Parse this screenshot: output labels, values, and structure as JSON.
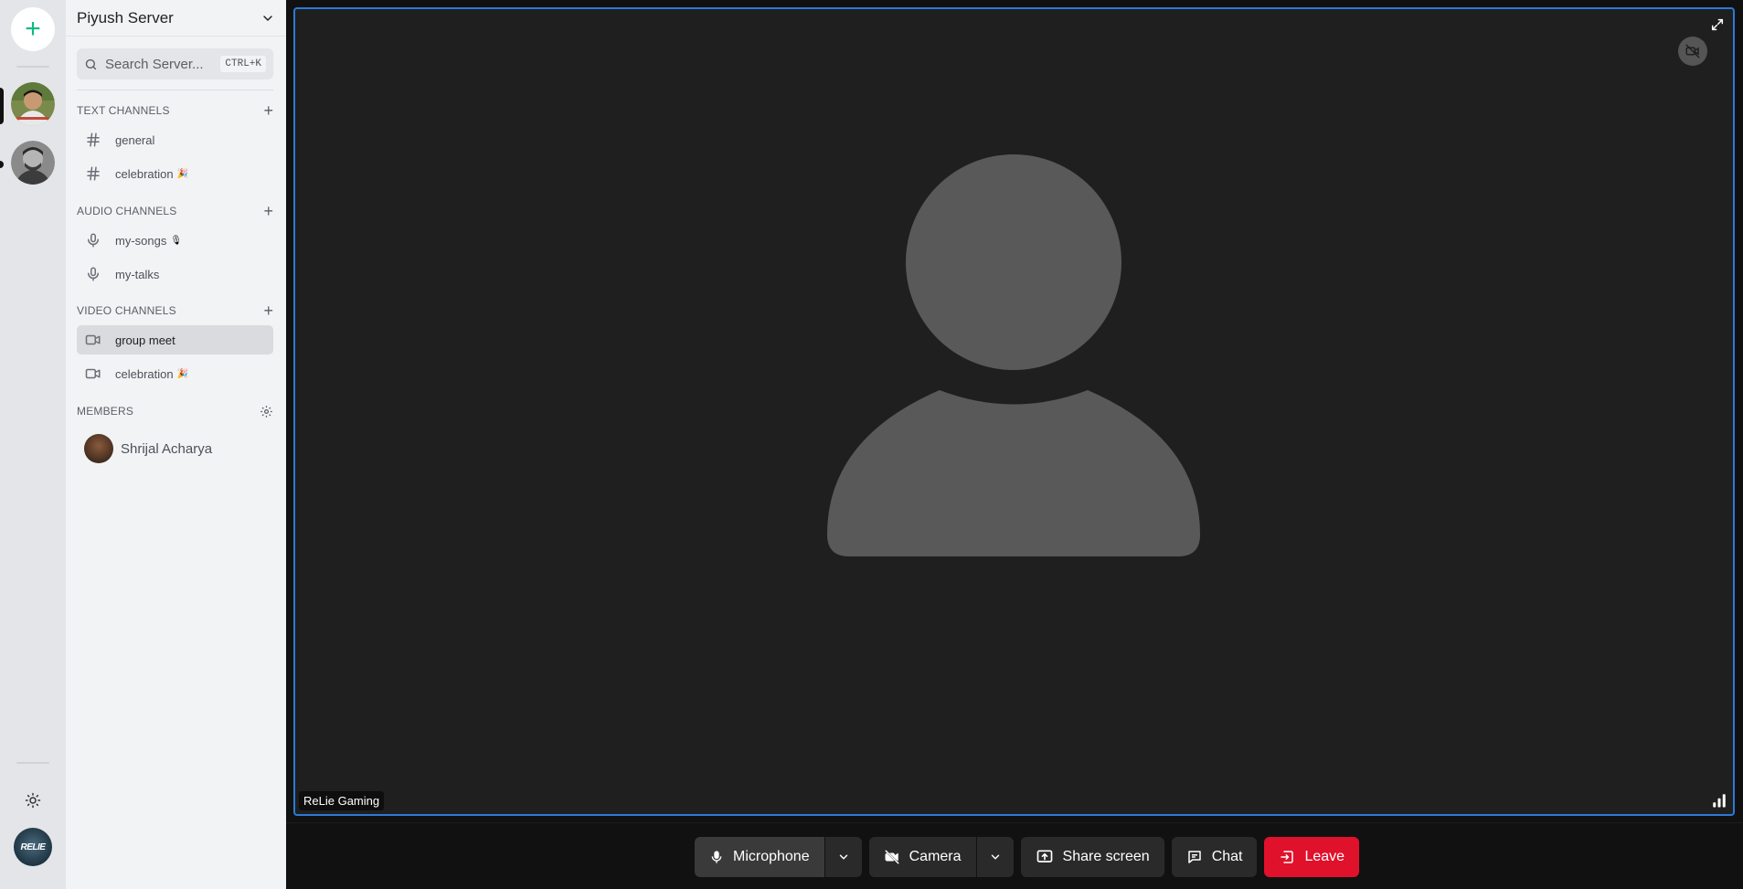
{
  "server": {
    "name": "Piyush Server"
  },
  "search": {
    "label": "Search Server...",
    "shortcut": "CTRL+K"
  },
  "sections": {
    "text": "TEXT CHANNELS",
    "audio": "AUDIO CHANNELS",
    "video": "VIDEO CHANNELS",
    "members": "MEMBERS"
  },
  "text_channels": [
    {
      "name": "general",
      "emoji": ""
    },
    {
      "name": "celebration",
      "emoji": "🎉"
    }
  ],
  "audio_channels": [
    {
      "name": "my-songs",
      "emoji": "🎙"
    },
    {
      "name": "my-talks",
      "emoji": ""
    }
  ],
  "video_channels": [
    {
      "name": "group meet",
      "emoji": "",
      "active": true
    },
    {
      "name": "celebration",
      "emoji": "🎉",
      "active": false
    }
  ],
  "members": [
    {
      "name": "Shrijal Acharya"
    }
  ],
  "user": {
    "avatar_text": "RELIE"
  },
  "stage": {
    "participant_name": "ReLie Gaming"
  },
  "controls": {
    "microphone": "Microphone",
    "camera": "Camera",
    "share_screen": "Share screen",
    "chat": "Chat",
    "leave": "Leave"
  },
  "colors": {
    "accent": "#2b7ad6",
    "leave": "#e0112b",
    "add": "#10b981"
  }
}
